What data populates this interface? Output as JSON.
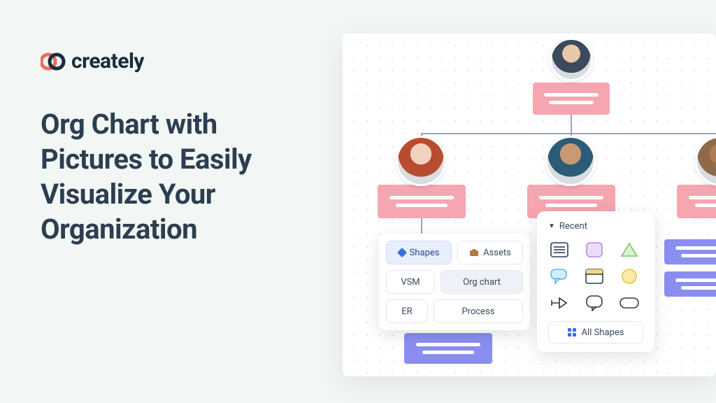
{
  "brand": {
    "name": "creately"
  },
  "headline": "Org Chart with Pictures to Easily Visualize Your Organization",
  "panel": {
    "tabs": {
      "shapes": "Shapes",
      "assets": "Assets",
      "vsm": "VSM",
      "orgchart": "Org chart",
      "er": "ER",
      "process": "Process"
    },
    "recent_label": "Recent",
    "all_shapes": "All Shapes"
  }
}
